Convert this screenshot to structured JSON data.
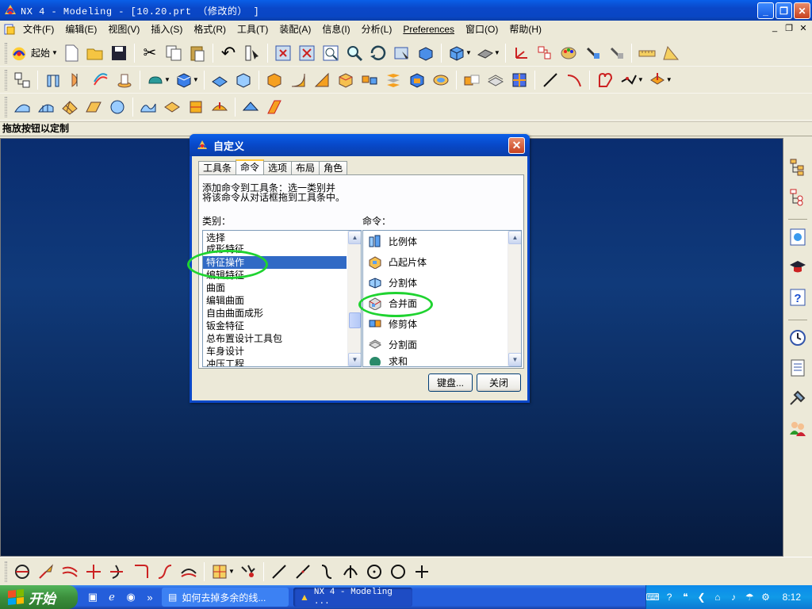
{
  "window": {
    "title": "NX 4 - Modeling - [10.20.prt （修改的） ]",
    "minimize": "_",
    "restore": "❐",
    "close": "✕"
  },
  "menu": {
    "items": [
      "文件(F)",
      "编辑(E)",
      "视图(V)",
      "插入(S)",
      "格式(R)",
      "工具(T)",
      "装配(A)",
      "信息(I)",
      "分析(L)",
      "Preferences",
      "窗口(O)",
      "帮助(H)"
    ]
  },
  "toolbar": {
    "start_label": "起始"
  },
  "status": {
    "hint": "拖放按钮以定制"
  },
  "dialog": {
    "title": "自定义",
    "tabs": [
      "工具条",
      "命令",
      "选项",
      "布局",
      "角色"
    ],
    "selected_tab": "命令",
    "instruction_line1": "添加命令到工具条：选一类别并",
    "instruction_line2": "将该命令从对话框拖到工具条中。",
    "categories_label": "类别：",
    "commands_label": "命令：",
    "categories": [
      "选择",
      "成形特征",
      "特征操作",
      "编辑特征",
      "曲面",
      "编辑曲面",
      "自由曲面成形",
      "钣金特征",
      "总布置设计工具包",
      "车身设计",
      "冲压工程"
    ],
    "selected_category": "特征操作",
    "commands": [
      "比例体",
      "凸起片体",
      "分割体",
      "合并面",
      "修剪体",
      "分割面",
      "求和"
    ],
    "keyboard_button": "键盘...",
    "close_button": "关闭"
  },
  "taskbar": {
    "start_label": "开始",
    "chevron": "»",
    "items": [
      {
        "label": "如何去掉多余的线..."
      },
      {
        "label": "NX 4 - Modeling ..."
      }
    ],
    "clock": "8:12"
  },
  "colors": {
    "title_blue": "#0a47c8",
    "selection": "#316ac5",
    "highlight_ring": "#1fd330",
    "canvas_top": "#0a2d70",
    "canvas_bottom": "#061a3e"
  }
}
